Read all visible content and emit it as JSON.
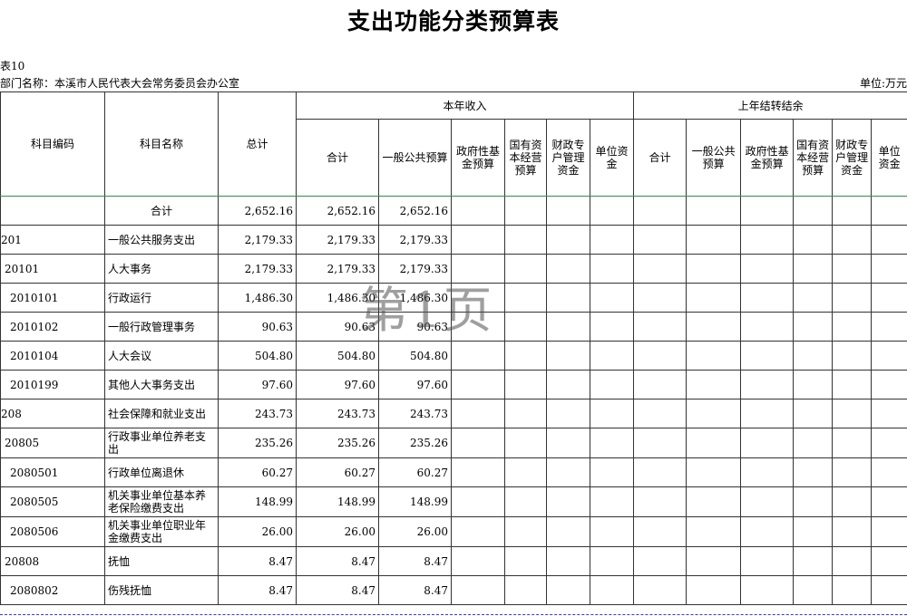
{
  "title": "支出功能分类预算表",
  "table_no": "表10",
  "department": "部门名称：本溪市人民代表大会常务委员会办公室",
  "unit": "单位:万元",
  "watermark": "第1页",
  "headers": {
    "code": "科目编码",
    "name": "科目名称",
    "total": "总计",
    "current_income": "本年收入",
    "prior_balance": "上年结转结余",
    "cur_sum": "合计",
    "cur_general": "一般公共预算",
    "cur_gov_fund": "政府性基金预算",
    "cur_state_capital": "国有资本经营预算",
    "cur_special": "财政专户管理资金",
    "cur_unit": "单位资金",
    "prior_sum": "合计",
    "prior_general": "一般公共预算",
    "prior_gov_fund": "政府性基金预算",
    "prior_state_capital": "国有资本经营预算",
    "prior_special": "财政专户管理资金",
    "prior_unit": "单位资金"
  },
  "rows": [
    {
      "code": "",
      "name": "合计",
      "total": "2,652.16",
      "sum": "2,652.16",
      "general": "2,652.16"
    },
    {
      "code": "201",
      "name": "一般公共服务支出",
      "total": "2,179.33",
      "sum": "2,179.33",
      "general": "2,179.33"
    },
    {
      "code": "20101",
      "name": "人大事务",
      "total": "2,179.33",
      "sum": "2,179.33",
      "general": "2,179.33"
    },
    {
      "code": "2010101",
      "name": "行政运行",
      "total": "1,486.30",
      "sum": "1,486.30",
      "general": "1,486.30"
    },
    {
      "code": "2010102",
      "name": "一般行政管理事务",
      "total": "90.63",
      "sum": "90.63",
      "general": "90.63"
    },
    {
      "code": "2010104",
      "name": "人大会议",
      "total": "504.80",
      "sum": "504.80",
      "general": "504.80"
    },
    {
      "code": "2010199",
      "name": "其他人大事务支出",
      "total": "97.60",
      "sum": "97.60",
      "general": "97.60"
    },
    {
      "code": "208",
      "name": "社会保障和就业支出",
      "total": "243.73",
      "sum": "243.73",
      "general": "243.73"
    },
    {
      "code": "20805",
      "name": "行政事业单位养老支出",
      "total": "235.26",
      "sum": "235.26",
      "general": "235.26"
    },
    {
      "code": "2080501",
      "name": "行政单位离退休",
      "total": "60.27",
      "sum": "60.27",
      "general": "60.27"
    },
    {
      "code": "2080505",
      "name": "机关事业单位基本养老保险缴费支出",
      "total": "148.99",
      "sum": "148.99",
      "general": "148.99"
    },
    {
      "code": "2080506",
      "name": "机关事业单位职业年金缴费支出",
      "total": "26.00",
      "sum": "26.00",
      "general": "26.00"
    },
    {
      "code": "20808",
      "name": "抚恤",
      "total": "8.47",
      "sum": "8.47",
      "general": "8.47"
    },
    {
      "code": "2080802",
      "name": "伤残抚恤",
      "total": "8.47",
      "sum": "8.47",
      "general": "8.47"
    }
  ]
}
